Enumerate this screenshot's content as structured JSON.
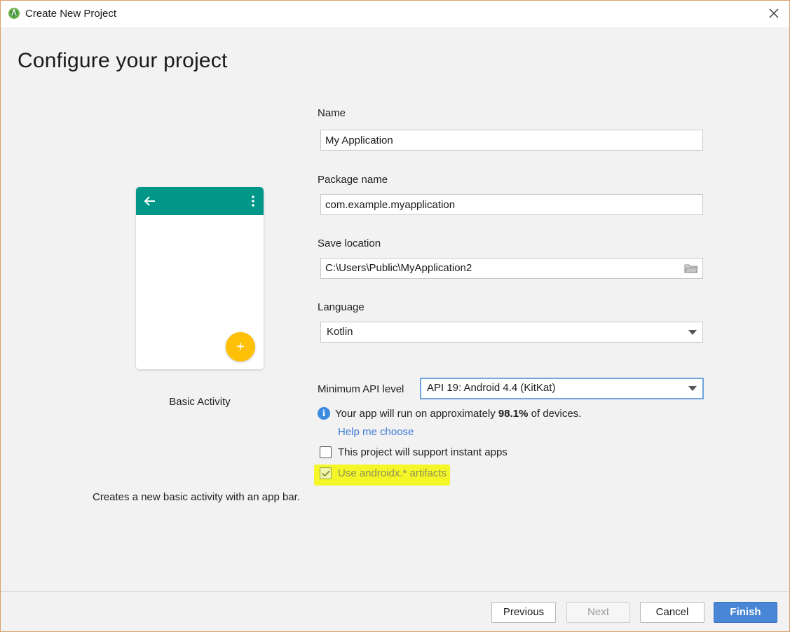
{
  "window": {
    "title": "Create New Project"
  },
  "page": {
    "heading": "Configure your project"
  },
  "template": {
    "label": "Basic Activity",
    "description": "Creates a new basic activity with an app bar.",
    "fab_symbol": "+",
    "colors": {
      "app_bar": "#009688",
      "fab": "#ffc107"
    }
  },
  "form": {
    "name": {
      "label": "Name",
      "value": "My Application"
    },
    "package": {
      "label": "Package name",
      "value": "com.example.myapplication"
    },
    "save_location": {
      "label": "Save location",
      "value": "C:\\Users\\Public\\MyApplication2"
    },
    "language": {
      "label": "Language",
      "value": "Kotlin"
    },
    "min_api": {
      "label": "Minimum API level",
      "value": "API 19: Android 4.4 (KitKat)"
    },
    "info": {
      "prefix": "Your app will run on approximately",
      "percent": "98.1%",
      "suffix": "of devices.",
      "icon": "i"
    },
    "help_link": "Help me choose",
    "instant_apps": {
      "label": "This project will support instant apps",
      "checked": false
    },
    "androidx": {
      "label": "Use androidx.* artifacts",
      "checked": true,
      "disabled": true
    }
  },
  "footer": {
    "previous": "Previous",
    "next": "Next",
    "cancel": "Cancel",
    "finish": "Finish"
  },
  "colors": {
    "accent": "#4a86d6",
    "link": "#3d7ad6",
    "highlight": "#f4f61c"
  }
}
